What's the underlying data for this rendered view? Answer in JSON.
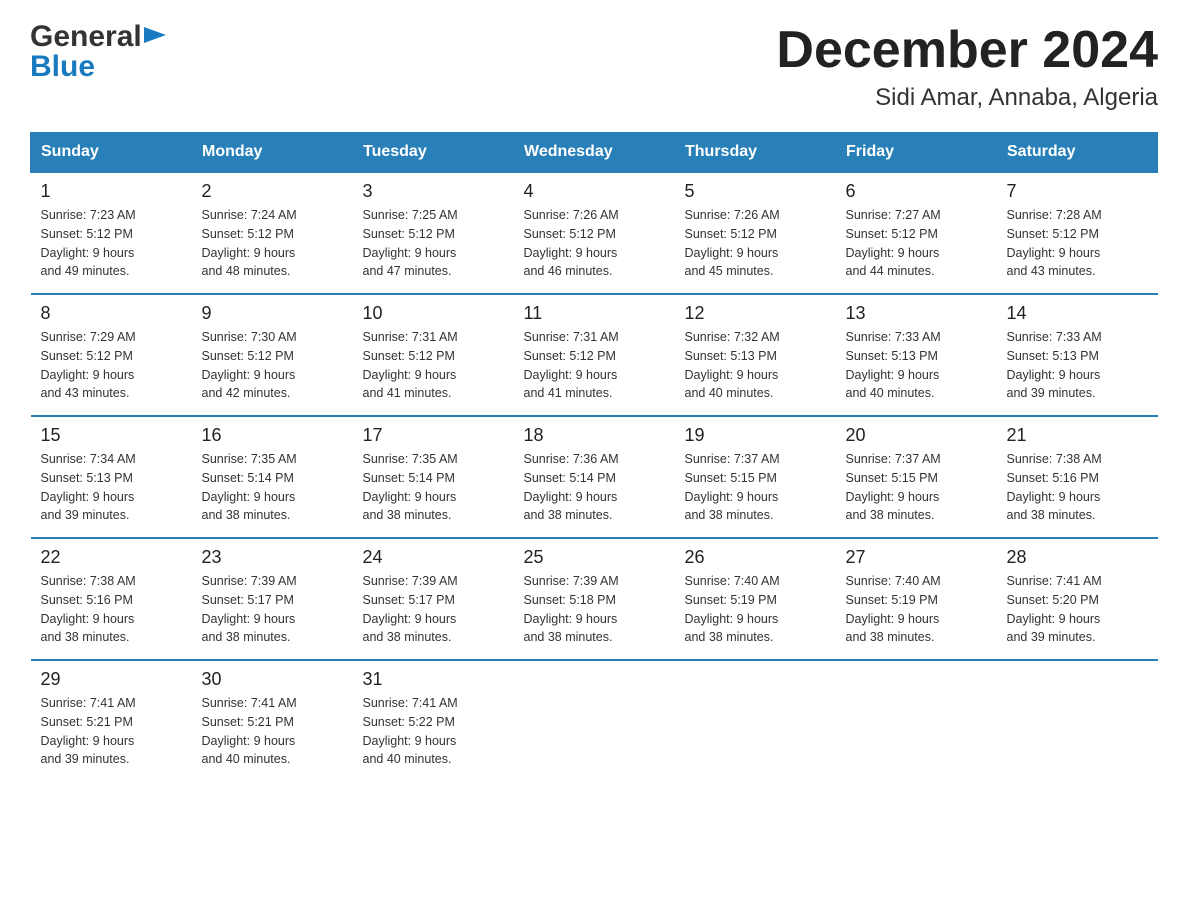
{
  "logo": {
    "general": "General",
    "blue": "Blue",
    "triangle": "▶"
  },
  "title": {
    "month_year": "December 2024",
    "location": "Sidi Amar, Annaba, Algeria"
  },
  "headers": [
    "Sunday",
    "Monday",
    "Tuesday",
    "Wednesday",
    "Thursday",
    "Friday",
    "Saturday"
  ],
  "weeks": [
    [
      {
        "day": "1",
        "sunrise": "7:23 AM",
        "sunset": "5:12 PM",
        "daylight": "9 hours and 49 minutes."
      },
      {
        "day": "2",
        "sunrise": "7:24 AM",
        "sunset": "5:12 PM",
        "daylight": "9 hours and 48 minutes."
      },
      {
        "day": "3",
        "sunrise": "7:25 AM",
        "sunset": "5:12 PM",
        "daylight": "9 hours and 47 minutes."
      },
      {
        "day": "4",
        "sunrise": "7:26 AM",
        "sunset": "5:12 PM",
        "daylight": "9 hours and 46 minutes."
      },
      {
        "day": "5",
        "sunrise": "7:26 AM",
        "sunset": "5:12 PM",
        "daylight": "9 hours and 45 minutes."
      },
      {
        "day": "6",
        "sunrise": "7:27 AM",
        "sunset": "5:12 PM",
        "daylight": "9 hours and 44 minutes."
      },
      {
        "day": "7",
        "sunrise": "7:28 AM",
        "sunset": "5:12 PM",
        "daylight": "9 hours and 43 minutes."
      }
    ],
    [
      {
        "day": "8",
        "sunrise": "7:29 AM",
        "sunset": "5:12 PM",
        "daylight": "9 hours and 43 minutes."
      },
      {
        "day": "9",
        "sunrise": "7:30 AM",
        "sunset": "5:12 PM",
        "daylight": "9 hours and 42 minutes."
      },
      {
        "day": "10",
        "sunrise": "7:31 AM",
        "sunset": "5:12 PM",
        "daylight": "9 hours and 41 minutes."
      },
      {
        "day": "11",
        "sunrise": "7:31 AM",
        "sunset": "5:12 PM",
        "daylight": "9 hours and 41 minutes."
      },
      {
        "day": "12",
        "sunrise": "7:32 AM",
        "sunset": "5:13 PM",
        "daylight": "9 hours and 40 minutes."
      },
      {
        "day": "13",
        "sunrise": "7:33 AM",
        "sunset": "5:13 PM",
        "daylight": "9 hours and 40 minutes."
      },
      {
        "day": "14",
        "sunrise": "7:33 AM",
        "sunset": "5:13 PM",
        "daylight": "9 hours and 39 minutes."
      }
    ],
    [
      {
        "day": "15",
        "sunrise": "7:34 AM",
        "sunset": "5:13 PM",
        "daylight": "9 hours and 39 minutes."
      },
      {
        "day": "16",
        "sunrise": "7:35 AM",
        "sunset": "5:14 PM",
        "daylight": "9 hours and 38 minutes."
      },
      {
        "day": "17",
        "sunrise": "7:35 AM",
        "sunset": "5:14 PM",
        "daylight": "9 hours and 38 minutes."
      },
      {
        "day": "18",
        "sunrise": "7:36 AM",
        "sunset": "5:14 PM",
        "daylight": "9 hours and 38 minutes."
      },
      {
        "day": "19",
        "sunrise": "7:37 AM",
        "sunset": "5:15 PM",
        "daylight": "9 hours and 38 minutes."
      },
      {
        "day": "20",
        "sunrise": "7:37 AM",
        "sunset": "5:15 PM",
        "daylight": "9 hours and 38 minutes."
      },
      {
        "day": "21",
        "sunrise": "7:38 AM",
        "sunset": "5:16 PM",
        "daylight": "9 hours and 38 minutes."
      }
    ],
    [
      {
        "day": "22",
        "sunrise": "7:38 AM",
        "sunset": "5:16 PM",
        "daylight": "9 hours and 38 minutes."
      },
      {
        "day": "23",
        "sunrise": "7:39 AM",
        "sunset": "5:17 PM",
        "daylight": "9 hours and 38 minutes."
      },
      {
        "day": "24",
        "sunrise": "7:39 AM",
        "sunset": "5:17 PM",
        "daylight": "9 hours and 38 minutes."
      },
      {
        "day": "25",
        "sunrise": "7:39 AM",
        "sunset": "5:18 PM",
        "daylight": "9 hours and 38 minutes."
      },
      {
        "day": "26",
        "sunrise": "7:40 AM",
        "sunset": "5:19 PM",
        "daylight": "9 hours and 38 minutes."
      },
      {
        "day": "27",
        "sunrise": "7:40 AM",
        "sunset": "5:19 PM",
        "daylight": "9 hours and 38 minutes."
      },
      {
        "day": "28",
        "sunrise": "7:41 AM",
        "sunset": "5:20 PM",
        "daylight": "9 hours and 39 minutes."
      }
    ],
    [
      {
        "day": "29",
        "sunrise": "7:41 AM",
        "sunset": "5:21 PM",
        "daylight": "9 hours and 39 minutes."
      },
      {
        "day": "30",
        "sunrise": "7:41 AM",
        "sunset": "5:21 PM",
        "daylight": "9 hours and 40 minutes."
      },
      {
        "day": "31",
        "sunrise": "7:41 AM",
        "sunset": "5:22 PM",
        "daylight": "9 hours and 40 minutes."
      },
      null,
      null,
      null,
      null
    ]
  ],
  "labels": {
    "sunrise": "Sunrise:",
    "sunset": "Sunset:",
    "daylight": "Daylight:"
  }
}
